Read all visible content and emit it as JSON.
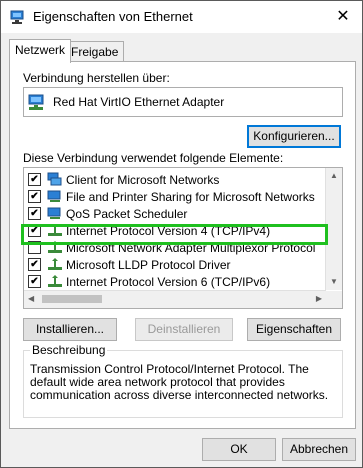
{
  "window": {
    "title": "Eigenschaften von Ethernet",
    "close_glyph": "✕"
  },
  "tabs": [
    {
      "label": "Netzwerk",
      "active": true
    },
    {
      "label": "Freigabe",
      "active": false
    }
  ],
  "connection": {
    "label": "Verbindung herstellen über:",
    "adapter": "Red Hat VirtIO Ethernet Adapter",
    "adapter_icon": "network-adapter-icon",
    "configure_button": "Konfigurieren..."
  },
  "items_label": "Diese Verbindung verwendet folgende Elemente:",
  "items": [
    {
      "label": "Client for Microsoft Networks",
      "checked": true,
      "icon": "network-client-icon"
    },
    {
      "label": "File and Printer Sharing for Microsoft Networks",
      "checked": true,
      "icon": "network-service-icon"
    },
    {
      "label": "QoS Packet Scheduler",
      "checked": true,
      "icon": "network-service-icon"
    },
    {
      "label": "Internet Protocol Version 4 (TCP/IPv4)",
      "checked": true,
      "icon": "network-protocol-icon",
      "highlighted": true
    },
    {
      "label": "Microsoft Network Adapter Multiplexor Protocol",
      "checked": false,
      "icon": "network-protocol-icon"
    },
    {
      "label": "Microsoft LLDP Protocol Driver",
      "checked": true,
      "icon": "network-protocol-icon"
    },
    {
      "label": "Internet Protocol Version 6 (TCP/IPv6)",
      "checked": true,
      "icon": "network-protocol-icon"
    }
  ],
  "check_glyph": "✔",
  "buttons": {
    "install": "Installieren...",
    "uninstall": "Deinstallieren",
    "properties": "Eigenschaften",
    "ok": "OK",
    "cancel": "Abbrechen"
  },
  "description": {
    "title": "Beschreibung",
    "text": "Transmission Control Protocol/Internet Protocol. The default wide area network protocol that provides communication across diverse interconnected networks."
  },
  "colors": {
    "highlight": "#1fc01f",
    "accent": "#0078d7"
  }
}
